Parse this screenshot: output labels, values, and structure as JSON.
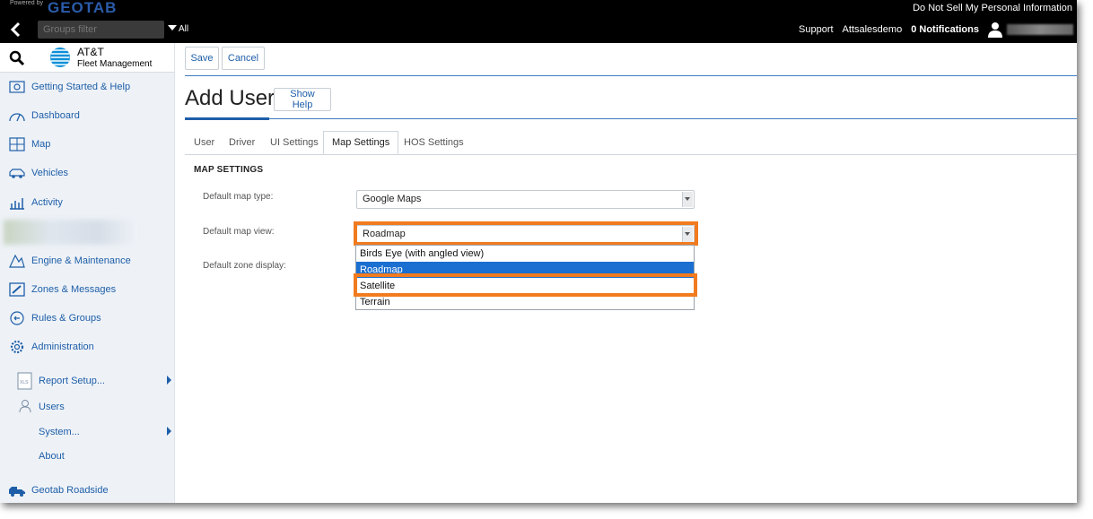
{
  "topbar": {
    "powered_by": "Powered by",
    "brand": "GEOTAB",
    "do_not_sell": "Do Not Sell My Personal Information"
  },
  "header": {
    "groups_filter_placeholder": "Groups filter",
    "all_label": "All",
    "support": "Support",
    "account": "Attsalesdemo",
    "notifications": "0 Notifications"
  },
  "sidebar": {
    "brand_name": "AT&T",
    "brand_sub": "Fleet Management",
    "items": [
      {
        "label": "Getting Started & Help",
        "icon": "help-box-icon"
      },
      {
        "label": "Dashboard",
        "icon": "gauge-icon"
      },
      {
        "label": "Map",
        "icon": "map-icon"
      },
      {
        "label": "Vehicles",
        "icon": "vehicle-icon"
      },
      {
        "label": "Activity",
        "icon": "activity-chart-icon"
      },
      {
        "label": "Engine & Maintenance",
        "icon": "engine-icon"
      },
      {
        "label": "Zones & Messages",
        "icon": "zones-icon"
      },
      {
        "label": "Rules & Groups",
        "icon": "rules-icon"
      },
      {
        "label": "Administration",
        "icon": "gear-icon"
      }
    ],
    "subitems": {
      "report_setup": "Report Setup...",
      "users": "Users",
      "system": "System...",
      "about": "About"
    },
    "roadside": "Geotab Roadside"
  },
  "toolbar": {
    "save_label": "Save",
    "cancel_label": "Cancel"
  },
  "page": {
    "title": "Add User",
    "show_help": "Show Help"
  },
  "tabs": [
    {
      "label": "User"
    },
    {
      "label": "Driver"
    },
    {
      "label": "UI Settings"
    },
    {
      "label": "Map Settings",
      "active": true
    },
    {
      "label": "HOS Settings"
    }
  ],
  "map_settings": {
    "section_title": "MAP SETTINGS",
    "map_type_label": "Default map type:",
    "map_type_value": "Google Maps",
    "map_view_label": "Default map view:",
    "map_view_value": "Roadmap",
    "zone_display_label": "Default zone display:",
    "map_view_options": [
      "Birds Eye (with angled view)",
      "Roadmap",
      "Satellite",
      "Terrain"
    ],
    "selected_option": "Roadmap",
    "highlighted_option": "Satellite"
  },
  "colors": {
    "highlight": "#f17b1e",
    "accent": "#1e5ea8",
    "selection": "#1a6fd1"
  }
}
